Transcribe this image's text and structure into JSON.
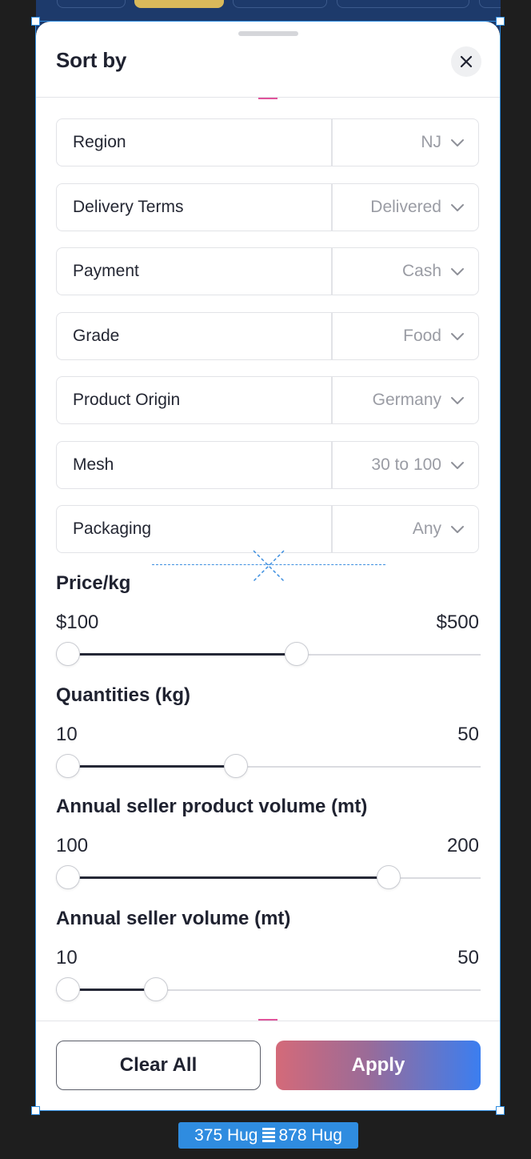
{
  "sheet": {
    "title": "Sort by"
  },
  "filters": [
    {
      "label": "Region",
      "value": "NJ"
    },
    {
      "label": "Delivery Terms",
      "value": "Delivered"
    },
    {
      "label": "Payment",
      "value": "Cash"
    },
    {
      "label": "Grade",
      "value": "Food"
    },
    {
      "label": "Product Origin",
      "value": "Germany"
    },
    {
      "label": "Mesh",
      "value": "30 to 100"
    },
    {
      "label": "Packaging",
      "value": "Any"
    }
  ],
  "ranges": [
    {
      "title": "Price/kg",
      "min_label": "$100",
      "max_label": "$500",
      "low_fraction": 0.0,
      "high_fraction": 0.57
    },
    {
      "title": "Quantities (kg)",
      "min_label": "10",
      "max_label": "50",
      "low_fraction": 0.0,
      "high_fraction": 0.42
    },
    {
      "title": "Annual seller product volume (mt)",
      "min_label": "100",
      "max_label": "200",
      "low_fraction": 0.0,
      "high_fraction": 0.8
    },
    {
      "title": "Annual seller volume (mt)",
      "min_label": "10",
      "max_label": "50",
      "low_fraction": 0.0,
      "high_fraction": 0.22
    }
  ],
  "footer": {
    "clear_label": "Clear All",
    "apply_label": "Apply"
  },
  "design_tool": {
    "width_text": "375 Hug",
    "height_text": "878 Hug"
  },
  "colors": {
    "accent_blue": "#2f8ce0",
    "apply_gradient_start": "#d46a79",
    "apply_gradient_end": "#3b7ef0",
    "marker_pink": "#e0549b"
  },
  "icons": {
    "close": "close-icon",
    "dropdown": "chevron-down-icon",
    "layout": "vertical-stack-icon"
  }
}
